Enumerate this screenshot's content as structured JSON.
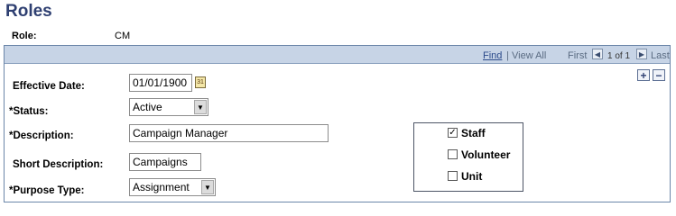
{
  "page": {
    "title": "Roles"
  },
  "role": {
    "label": "Role:",
    "value": "CM"
  },
  "grid_nav": {
    "find": "Find",
    "separator": "|",
    "view_all": "View All",
    "first": "First",
    "count": "1 of 1",
    "last": "Last",
    "prev_icon": "prev-arrow-icon",
    "next_icon": "next-arrow-icon"
  },
  "row_actions": {
    "add": "+",
    "delete": "−"
  },
  "form": {
    "effective_date": {
      "label": "Effective Date:",
      "value": "01/01/1900",
      "icon": "calendar-icon"
    },
    "status": {
      "label": "*Status:",
      "value": "Active"
    },
    "description": {
      "label": "*Description:",
      "value": "Campaign Manager"
    },
    "short_description": {
      "label": "Short Description:",
      "value": "Campaigns"
    },
    "purpose_type": {
      "label": "*Purpose Type:",
      "value": "Assignment"
    }
  },
  "role_types": [
    {
      "label": "Staff",
      "checked": true
    },
    {
      "label": "Volunteer",
      "checked": false
    },
    {
      "label": "Unit",
      "checked": false
    }
  ],
  "colors": {
    "title": "#2e3f71",
    "header_bg": "#c7d4e6",
    "panel_border": "#6b86a9"
  }
}
